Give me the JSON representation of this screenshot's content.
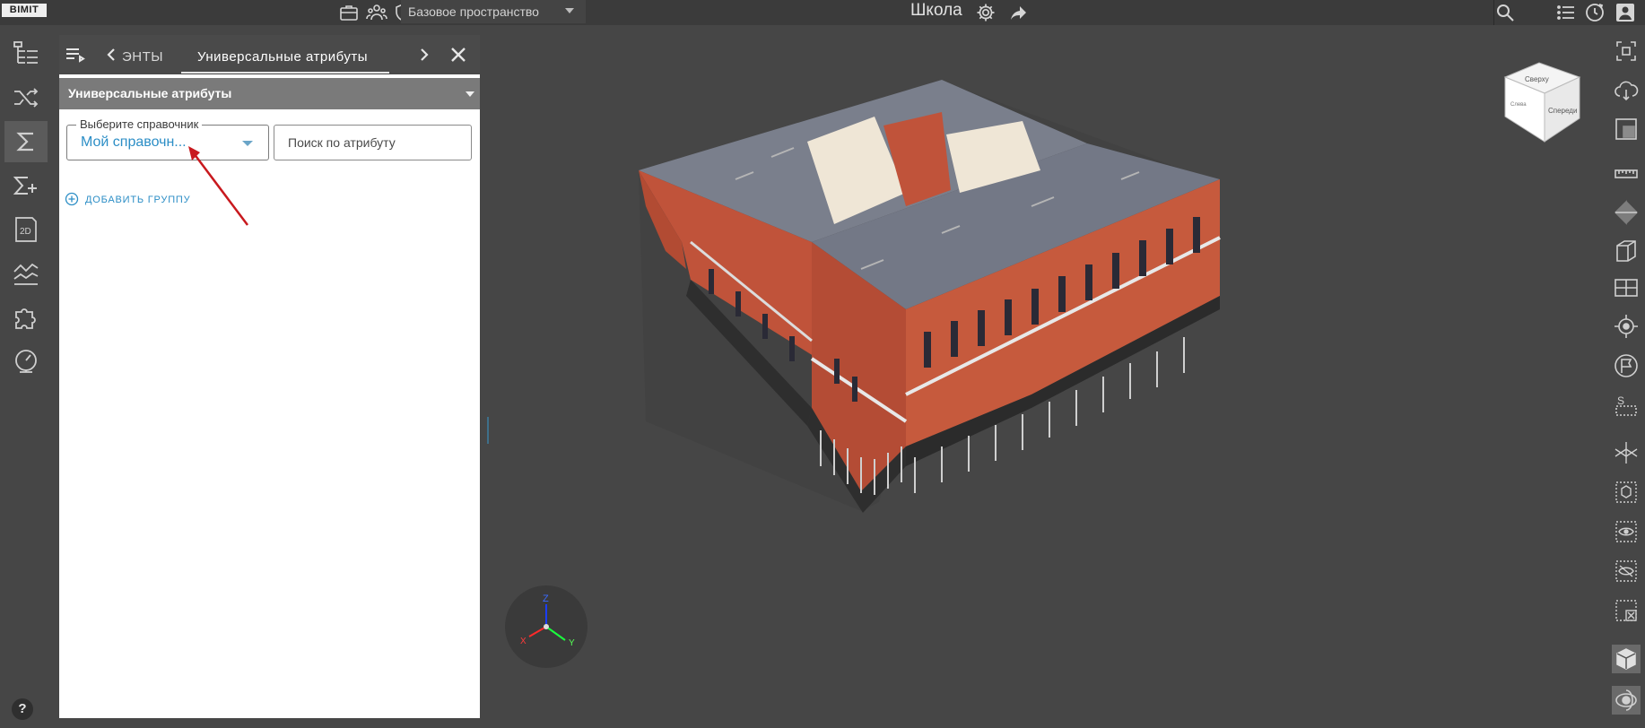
{
  "app": {
    "logo_text": "BIMIT",
    "workspace": "Базовое пространство",
    "project_title": "Школа"
  },
  "panel": {
    "tab_prev_label": "ЭНТЫ",
    "tab_active_label": "Универсальные атрибуты",
    "group_title": "Универсальные атрибуты",
    "reference_select": {
      "legend": "Выберите справочник",
      "value": "Мой справочн..."
    },
    "attribute_search": {
      "placeholder": "Поиск по атрибуту"
    },
    "add_group_label": "ДОБАВИТЬ ГРУППУ"
  },
  "axis_gizmo": {
    "z_label": "Z",
    "y_label": "Y",
    "x_label": "X"
  },
  "viewcube": {
    "face_top": "Сверху",
    "face_right": "Спереди",
    "face_left": "Слева"
  },
  "help_label": "?",
  "colors": {
    "accent": "#2c8ec6",
    "background": "#464646",
    "topbar": "#3b3b3b",
    "brick": "#c0533a",
    "roof": "#7a7f8c"
  },
  "left_rail_icons": [
    "tree-icon",
    "shuffle-icon",
    "sigma-icon",
    "sigma-plus-icon",
    "2d-sheet-icon",
    "chart-lines-icon",
    "puzzle-icon",
    "gauge-icon"
  ],
  "right_toolbar_icons": [
    "focus-icon",
    "cloud-sync-icon",
    "select-box-icon",
    "ruler-icon",
    "section-plane-icon",
    "section-box-icon",
    "plan-view-icon",
    "target-icon",
    "flag-icon",
    "scale-icon",
    "clash-icon",
    "isolate-icon",
    "show-icon",
    "hide-icon",
    "remove-icon",
    "solid-cube-icon",
    "orbit-icon"
  ]
}
